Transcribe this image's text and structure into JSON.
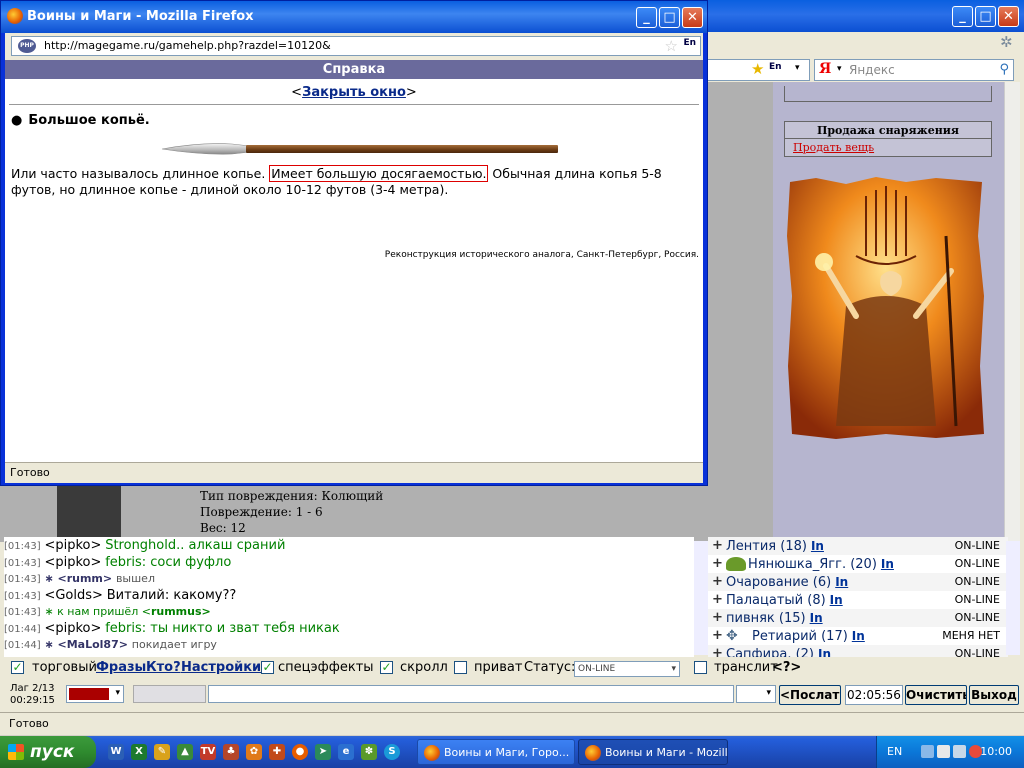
{
  "main_window": {
    "search": {
      "logo": "Я",
      "placeholder": "Яндекс"
    },
    "shop": {
      "title": "Продажа снаряжения",
      "link": "Продать вещь"
    },
    "item_info": {
      "damage_type": "Тип повреждения: Колющий",
      "damage": "Повреждение: 1 - 6",
      "weight": "Вес: 12"
    },
    "status_text": "Готово"
  },
  "chat": {
    "lines": [
      {
        "time": "[01:43]",
        "nick": "<pipko>",
        "msg": "Stronghold.. алкаш сраний",
        "kind": "msg"
      },
      {
        "time": "[01:43]",
        "nick": "<pipko>",
        "msg": "febris: соси фуфло",
        "kind": "msg"
      },
      {
        "time": "[01:43]",
        "nick": "∗ <rumm>",
        "msg": "вышел",
        "kind": "sys"
      },
      {
        "time": "[01:43]",
        "nick": "<Golds>",
        "msg": "Виталий: какому??",
        "kind": "plain"
      },
      {
        "time": "[01:43]",
        "nick": "∗ к нам пришёл <",
        "msg": "rummus>",
        "kind": "join"
      },
      {
        "time": "[01:44]",
        "nick": "<pipko>",
        "msg": "febris: ты никто и зват тебя никак",
        "kind": "msg"
      },
      {
        "time": "[01:44]",
        "nick": "∗ <MaLol87>",
        "msg": "покидает игру",
        "kind": "sys"
      }
    ]
  },
  "players": [
    {
      "name": "Лентия (18)",
      "link": "In",
      "status": "ON-LINE"
    },
    {
      "name": "Нянюшка_Ягг. (20)",
      "link": "In",
      "status": "ON-LINE"
    },
    {
      "name": "Очарование (6)",
      "link": "In",
      "status": "ON-LINE"
    },
    {
      "name": "Палацатый (8)",
      "link": "In",
      "status": "ON-LINE"
    },
    {
      "name": "пивняк (15)",
      "link": "In",
      "status": "ON-LINE"
    },
    {
      "name": "Ретиарий (17)",
      "link": "In",
      "status": "МЕНЯ НЕТ"
    },
    {
      "name": "Сапфира. (2)",
      "link": "In",
      "status": "ON-LINE"
    }
  ],
  "controls": {
    "trade_label": "торговый",
    "phrases": "Фразы",
    "who": "Кто?",
    "settings": "Настройки",
    "effects_label": "спецэффекты",
    "scroll_label": "скролл",
    "private_label": "приват",
    "status_label": "Статус:",
    "status_value": "ON-LINE",
    "translit_label": "транслит",
    "translit_help": "<?>",
    "lag": "Лаг 2/13",
    "timer": "00:29:15",
    "send_button": "<Послать",
    "clock": "02:05:56",
    "clear_button": "Очистить",
    "exit_button": "Выход"
  },
  "popup": {
    "title": "Воины и Маги - Mozilla Firefox",
    "url": "http://magegame.ru/gamehelp.php?razdel=10120&",
    "url_badge": "En",
    "header": "Справка",
    "close_link": "Закрыть окно",
    "close_left": "<",
    "close_right": ">",
    "item_name": "Большое копьё.",
    "desc_start": "Или часто называлось длинное копье.",
    "desc_highlight": "Имеет большую досягаемостью.",
    "desc_end": "Обычная длина копья 5-8 футов, но длинное копье - длиной около 10-12 футов (3-4 метра).",
    "caption": "Реконструкция исторического аналога, Санкт-Петербург, Россия.",
    "status": "Готово"
  },
  "taskbar": {
    "start": "пуск",
    "tasks": [
      {
        "label": "Воины и Маги, Горо..."
      },
      {
        "label": "Воины и Маги - Mozill..."
      }
    ],
    "lang": "EN",
    "time": "10:00"
  }
}
